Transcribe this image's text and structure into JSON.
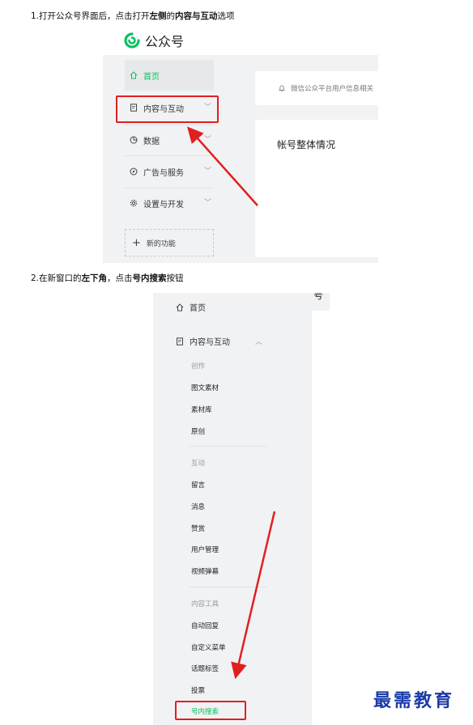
{
  "step1": {
    "prefix": "1.打开公众号界面后，点击打开",
    "bold1": "左侧",
    "mid": "的",
    "bold2": "内容与互动",
    "suffix": "选项"
  },
  "step2": {
    "prefix": "2.在新窗口的",
    "bold1": "左下角",
    "mid": "，点击",
    "bold2": "号内搜索",
    "suffix": "按钮"
  },
  "shot1": {
    "logo_text": "公众号",
    "sidebar": [
      {
        "label": "首页",
        "icon": "home-icon",
        "active": true
      },
      {
        "label": "内容与互动",
        "icon": "document-icon"
      },
      {
        "label": "数据",
        "icon": "pie-chart-icon"
      },
      {
        "label": "广告与服务",
        "icon": "compass-icon"
      },
      {
        "label": "设置与开发",
        "icon": "gear-icon"
      }
    ],
    "new_function": "新的功能",
    "notice": "微信公众平台用户信息相关",
    "panel_title": "帐号整体情况"
  },
  "shot2": {
    "home": "首页",
    "content_interaction": "内容与互动",
    "groups": [
      {
        "title": "创作",
        "items": [
          "图文素材",
          "素材库",
          "原创"
        ]
      },
      {
        "title": "互动",
        "items": [
          "留言",
          "消息",
          "赞赏",
          "用户管理",
          "视频弹幕"
        ]
      },
      {
        "title": "内容工具",
        "items": [
          "自动回复",
          "自定义菜单",
          "话题标签",
          "投票",
          "号内搜索"
        ]
      }
    ]
  },
  "watermark": "最需教育",
  "colors": {
    "accent": "#07c160",
    "highlight": "#e02020",
    "watermark": "#1a3aa8"
  }
}
